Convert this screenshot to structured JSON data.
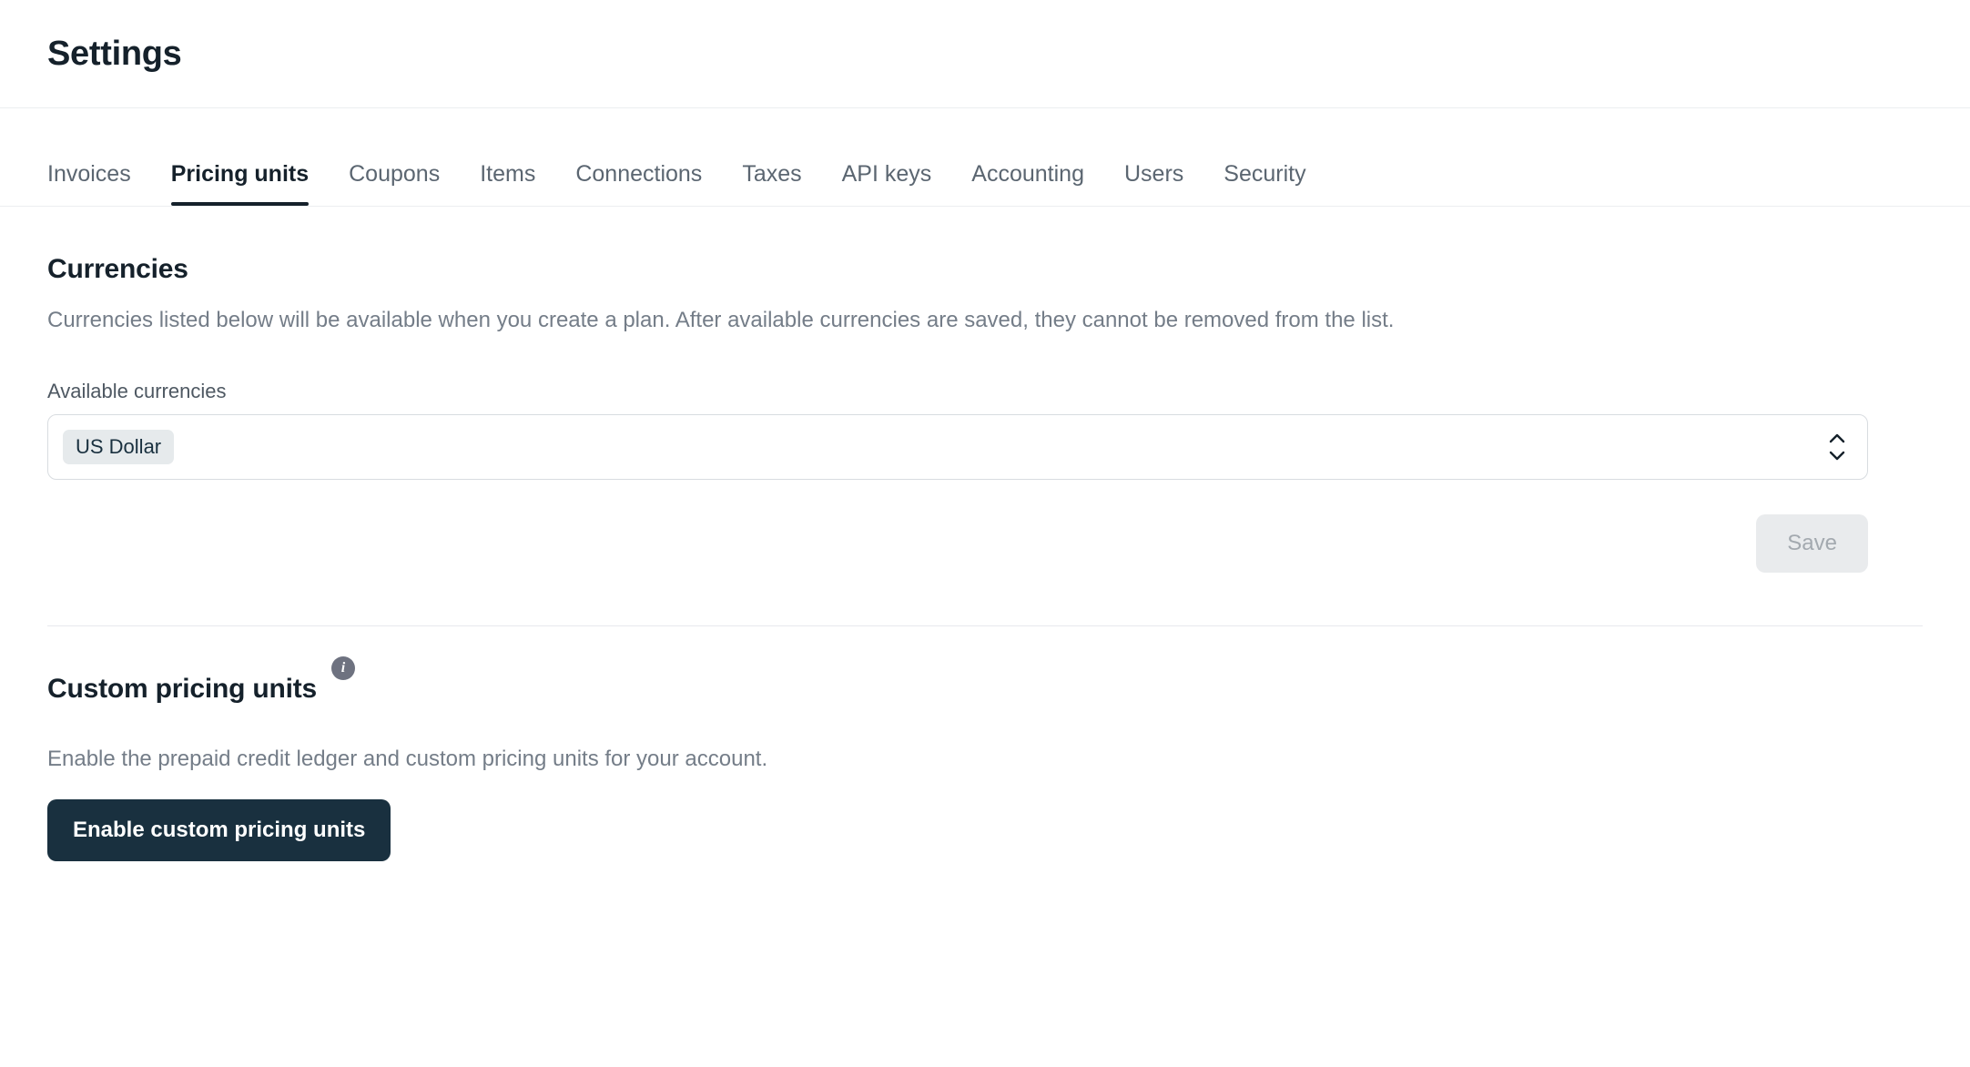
{
  "header": {
    "title": "Settings"
  },
  "tabs": [
    {
      "label": "Invoices",
      "active": false
    },
    {
      "label": "Pricing units",
      "active": true
    },
    {
      "label": "Coupons",
      "active": false
    },
    {
      "label": "Items",
      "active": false
    },
    {
      "label": "Connections",
      "active": false
    },
    {
      "label": "Taxes",
      "active": false
    },
    {
      "label": "API keys",
      "active": false
    },
    {
      "label": "Accounting",
      "active": false
    },
    {
      "label": "Users",
      "active": false
    },
    {
      "label": "Security",
      "active": false
    }
  ],
  "currencies": {
    "title": "Currencies",
    "description": "Currencies listed below will be available when you create a plan. After available currencies are saved, they cannot be removed from the list.",
    "field_label": "Available currencies",
    "selected": [
      "US Dollar"
    ],
    "indicator_icon": "chevron-up-down-icon",
    "save_label": "Save",
    "save_disabled": true
  },
  "custom_pricing_units": {
    "title": "Custom pricing units",
    "info_icon": "info-icon",
    "info_glyph": "i",
    "description": "Enable the prepaid credit ledger and custom pricing units for your account.",
    "enable_label": "Enable custom pricing units"
  },
  "colors": {
    "primary": "#19303f",
    "title": "#15212b",
    "muted_text": "#747d88",
    "chip_bg": "#e6eaec",
    "border": "#d8dce0",
    "divider": "#e7e9ed",
    "disabled_bg": "#e9ebed",
    "disabled_text": "#a3a9af",
    "info_bg": "#6e7280"
  }
}
